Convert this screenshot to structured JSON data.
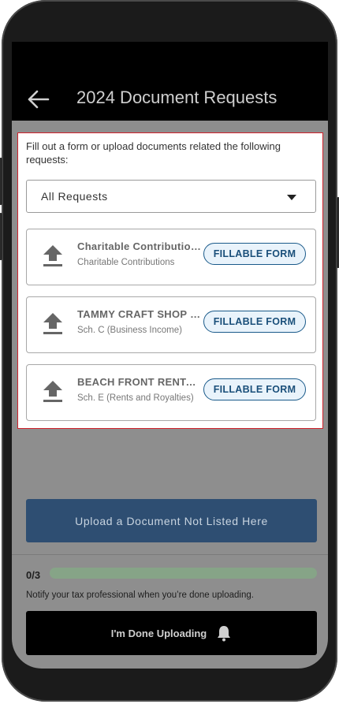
{
  "header": {
    "back_icon": "arrow-left-icon",
    "title": "2024 Document Requests"
  },
  "panel": {
    "intro": "Fill out a form or upload documents related the following requests:",
    "filter": {
      "selected": "All Requests",
      "icon": "caret-down-icon"
    }
  },
  "requests": [
    {
      "name": "Charitable Contributions",
      "subtitle": "Charitable Contributions",
      "action": "FILLABLE FORM",
      "icon": "upload-icon"
    },
    {
      "name": "TAMMY CRAFT SHOP (T...",
      "subtitle": "Sch. C (Business Income)",
      "action": "FILLABLE FORM",
      "icon": "upload-icon"
    },
    {
      "name": "BEACH FRONT RENTAL  ...",
      "subtitle": "Sch. E (Rents and Royalties)",
      "action": "FILLABLE FORM",
      "icon": "upload-icon"
    }
  ],
  "footer": {
    "upload_other": "Upload a Document Not Listed Here",
    "progress": {
      "label": "0/3",
      "done": 0,
      "total": 3
    },
    "notify": "Notify your tax professional when you’re done uploading.",
    "done_button": "I'm Done Uploading",
    "bell_icon": "bell-icon"
  },
  "colors": {
    "accent": "#1a5a8a",
    "highlight_border": "#d0202a",
    "progress_track": "#86a487"
  }
}
